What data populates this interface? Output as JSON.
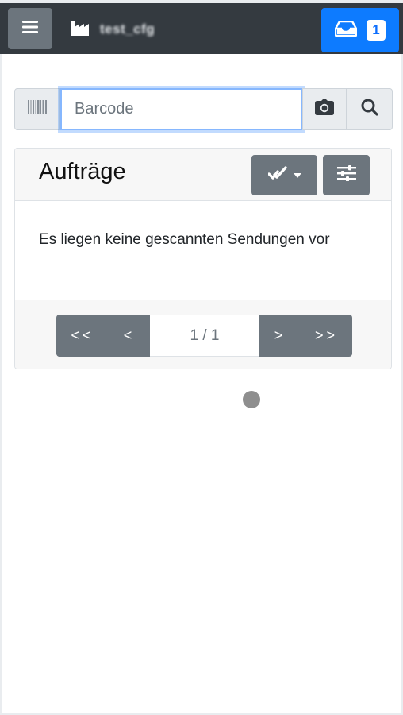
{
  "navbar": {
    "menu_icon": "hamburger-icon",
    "brand_icon": "factory-icon",
    "brand_text": "test_cfg",
    "inbox_icon": "inbox-icon",
    "inbox_count": "1"
  },
  "search": {
    "barcode_icon": "barcode-icon",
    "placeholder": "Barcode",
    "value": "",
    "camera_icon": "camera-icon",
    "search_icon": "search-icon"
  },
  "orders": {
    "title": "Aufträge",
    "check_icon": "double-check-icon",
    "filter_icon": "sliders-icon",
    "empty_message": "Es liegen keine gescannten Sendungen vor"
  },
  "pagination": {
    "first": "<<",
    "prev": "<",
    "page_info": "1 / 1",
    "next": ">",
    "last": ">>"
  },
  "colors": {
    "navbar_bg": "#343a40",
    "primary": "#0d7bff",
    "secondary": "#6c757d"
  }
}
